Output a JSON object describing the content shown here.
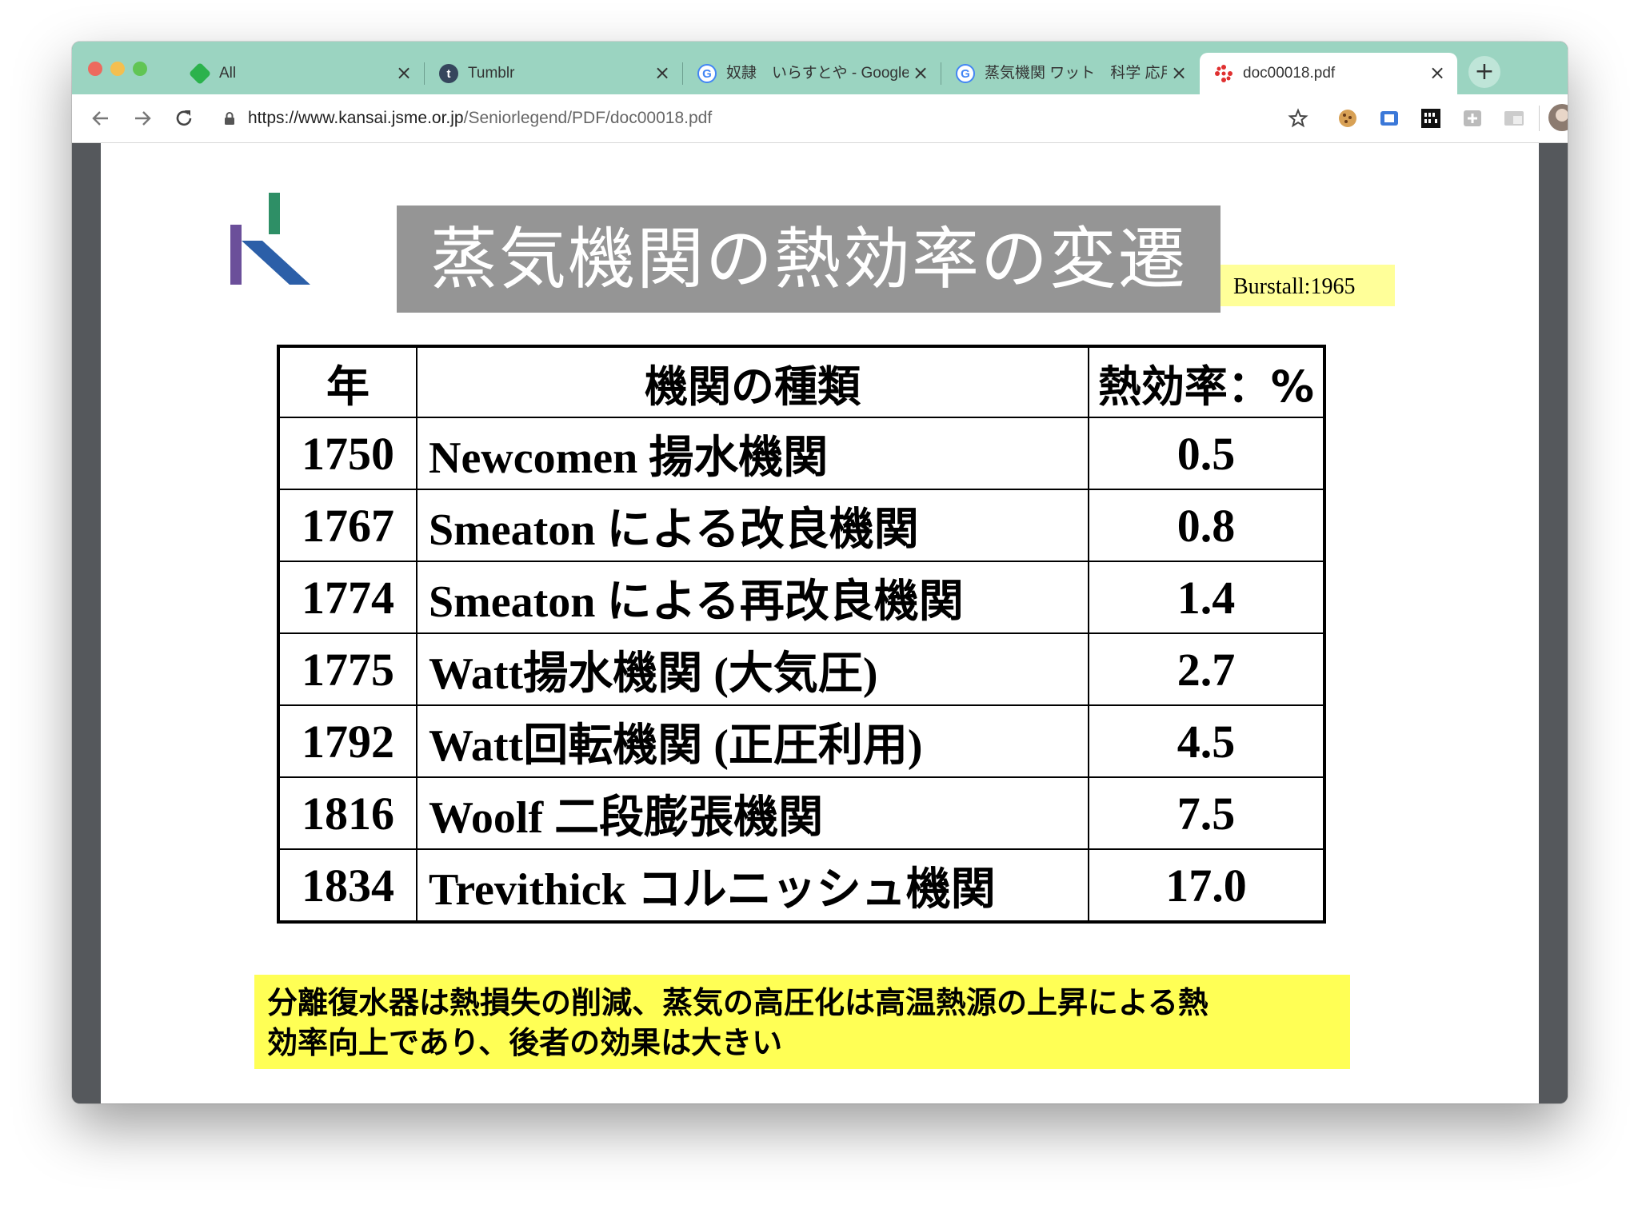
{
  "browser": {
    "tabs": [
      {
        "title": "All",
        "icon": "feedly-icon",
        "active": false
      },
      {
        "title": "Tumblr",
        "icon": "tumblr-icon",
        "active": false
      },
      {
        "title": "奴隷　いらすとや - Google",
        "icon": "google-icon",
        "active": false
      },
      {
        "title": "蒸気機関 ワット　科学 応用",
        "icon": "google-icon",
        "active": false
      },
      {
        "title": "doc00018.pdf",
        "icon": "pdf-icon",
        "active": true
      }
    ],
    "tab_close_glyph": "×",
    "new_tab_glyph": "+",
    "url_host": "https://www.kansai.jsme.or.jp",
    "url_path": "/Seniorlegend/PDF/doc00018.pdf",
    "colors": {
      "tabstrip": "#9bd4c1",
      "viewer_bg": "#55585c"
    }
  },
  "slide": {
    "title": "蒸気機関の熱効率の変遷",
    "citation": "Burstall:1965",
    "table": {
      "headers": [
        "年",
        "機関の種類",
        "熱効率：%"
      ],
      "rows": [
        {
          "year": "1750",
          "engine": "Newcomen 揚水機関",
          "efficiency": "0.5"
        },
        {
          "year": "1767",
          "engine": "Smeaton による改良機関",
          "efficiency": "0.8"
        },
        {
          "year": "1774",
          "engine": "Smeaton による再改良機関",
          "efficiency": "1.4"
        },
        {
          "year": "1775",
          "engine": "Watt揚水機関 (大気圧)",
          "efficiency": "2.7"
        },
        {
          "year": "1792",
          "engine": "Watt回転機関 (正圧利用)",
          "efficiency": "4.5"
        },
        {
          "year": "1816",
          "engine": "Woolf 二段膨張機関",
          "efficiency": "7.5"
        },
        {
          "year": "1834",
          "engine": "Trevithick コルニッシュ機関",
          "efficiency": "17.0"
        }
      ]
    },
    "note_line1": "分離復水器は熱損失の削減、蒸気の高圧化は高温熱源の上昇による熱",
    "note_line2": "効率向上であり、後者の効果は大きい",
    "colors": {
      "title_bg": "#959595",
      "citation_bg": "#ffff99",
      "note_bg": "#ffff55"
    }
  }
}
